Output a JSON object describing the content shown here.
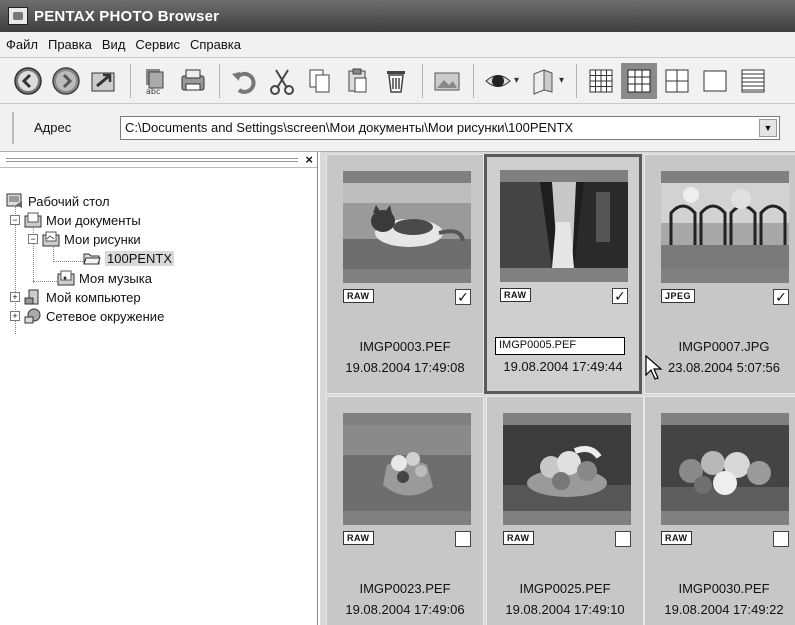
{
  "window": {
    "title": "PENTAX PHOTO Browser"
  },
  "menu": [
    "Файл",
    "Правка",
    "Вид",
    "Сервис",
    "Справка"
  ],
  "toolbar": {
    "buttons": [
      "back-icon",
      "forward-icon",
      "up-folder-icon",
      "spellcheck-icon",
      "print-icon",
      "undo-icon",
      "cut-icon",
      "copy-icon",
      "paste-icon",
      "delete-icon",
      "image-icon",
      "view-eye-icon",
      "view-pages-icon",
      "grid-small-icon",
      "grid-medium-icon",
      "grid-large-icon",
      "single-view-icon",
      "details-icon"
    ],
    "active_view": "grid-medium-icon"
  },
  "address": {
    "label": "Адрес",
    "value": "C:\\Documents and Settings\\screen\\Мои документы\\Мои рисунки\\100PENTX"
  },
  "tree": {
    "items": [
      {
        "label": "Рабочий стол",
        "icon": "desktop-icon"
      },
      {
        "label": "Мои документы",
        "icon": "documents-folder-icon",
        "expander": "−"
      },
      {
        "label": "Мои рисунки",
        "icon": "pictures-folder-icon",
        "expander": "−"
      },
      {
        "label": "100PENTX",
        "icon": "folder-open-icon",
        "selected": true
      },
      {
        "label": "Моя музыка",
        "icon": "music-folder-icon"
      },
      {
        "label": "Мой компьютер",
        "icon": "computer-icon",
        "expander": "+"
      },
      {
        "label": "Сетевое окружение",
        "icon": "network-icon",
        "expander": "+"
      }
    ]
  },
  "thumbnails": [
    {
      "name": "IMGP0003.PEF",
      "date": "19.08.2004 17:49:08",
      "badge": "RAW",
      "checked": true,
      "subject": "cat"
    },
    {
      "name": "IMGP0005.PEF",
      "date": "19.08.2004 17:49:44",
      "badge": "RAW",
      "checked": true,
      "subject": "alley",
      "selected": true,
      "renaming": true
    },
    {
      "name": "IMGP0007.JPG",
      "date": "23.08.2004 5:07:56",
      "badge": "JPEG",
      "checked": true,
      "subject": "fence"
    },
    {
      "name": "IMGP0023.PEF",
      "date": "19.08.2004 17:49:06",
      "badge": "RAW",
      "checked": false,
      "subject": "flowers"
    },
    {
      "name": "IMGP0025.PEF",
      "date": "19.08.2004 17:49:10",
      "badge": "RAW",
      "checked": false,
      "subject": "fruit-basket"
    },
    {
      "name": "IMGP0030.PEF",
      "date": "19.08.2004 17:49:22",
      "badge": "RAW",
      "checked": false,
      "subject": "fruit-pile"
    }
  ],
  "colors": {
    "titlebar": "#4a4a4a",
    "grid_bg": "#d9d9d9",
    "selected_border": "#5a5a5a"
  }
}
